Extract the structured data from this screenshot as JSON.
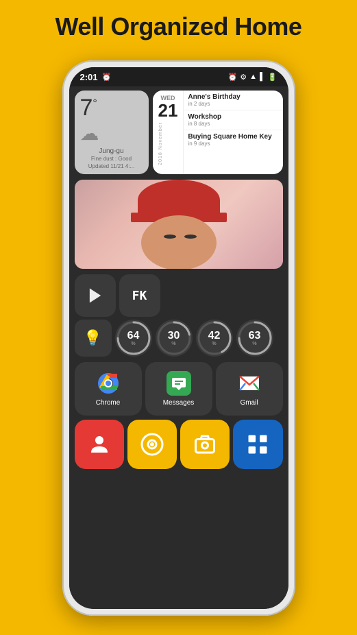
{
  "page": {
    "title": "Well Organized Home",
    "background_color": "#F5B800"
  },
  "phone": {
    "status_bar": {
      "time": "2:01",
      "left_icons": [
        "alarm"
      ],
      "right_icons": [
        "alarm2",
        "settings",
        "wifi",
        "signal",
        "battery"
      ]
    },
    "weather_widget": {
      "temperature": "7",
      "unit": "°",
      "location": "Jung-gu",
      "dust_label": "Fine dust : Good",
      "updated": "Updated 11/21 4:...",
      "icon": "cloud"
    },
    "calendar_widget": {
      "day_name": "WED",
      "day_number": "21",
      "year": "2018",
      "month": "November",
      "events": [
        {
          "title": "Anne's Birthday",
          "subtitle": "in 2 days"
        },
        {
          "title": "Workshop",
          "subtitle": "in 8 days"
        },
        {
          "title": "Buying Square Home Key",
          "subtitle": "in 9 days"
        }
      ]
    },
    "quick_tiles_row1": [
      {
        "label": "",
        "icon": "play-store"
      },
      {
        "label": "",
        "icon": "file-manager",
        "text": "FK"
      }
    ],
    "widget_row": {
      "bulb_icon": "💡",
      "progress_tiles": [
        {
          "value": 64,
          "pct": "%"
        },
        {
          "value": 30,
          "pct": "%"
        },
        {
          "value": 42,
          "pct": "%"
        },
        {
          "value": 63,
          "pct": "%"
        }
      ]
    },
    "app_row_main": [
      {
        "id": "chrome",
        "label": "Chrome"
      },
      {
        "id": "messages",
        "label": "Messages"
      },
      {
        "id": "gmail",
        "label": "Gmail"
      }
    ],
    "bottom_tiles": [
      {
        "id": "contacts",
        "color": "red",
        "icon": "person"
      },
      {
        "id": "unknown1",
        "color": "yellow",
        "icon": "camera-circle"
      },
      {
        "id": "unknown2",
        "color": "yellow",
        "icon": "camera-photo"
      },
      {
        "id": "apps",
        "color": "blue",
        "icon": "grid"
      }
    ]
  }
}
